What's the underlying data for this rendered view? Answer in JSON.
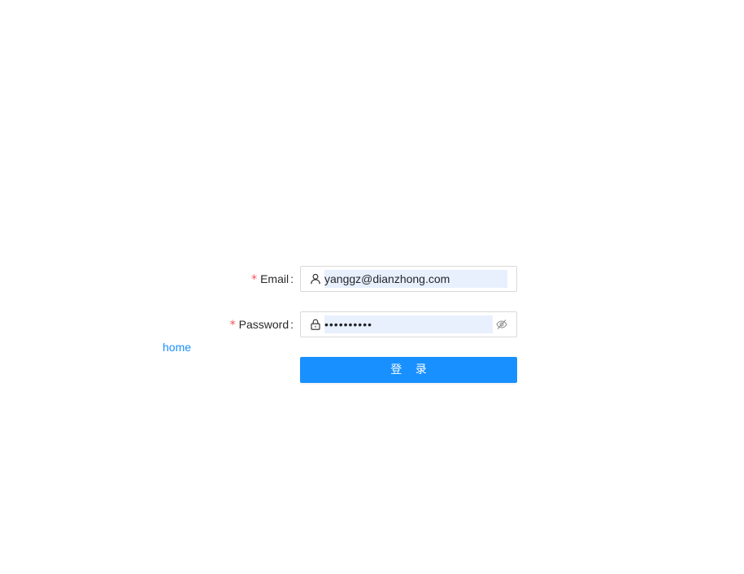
{
  "nav": {
    "home_label": "home"
  },
  "form": {
    "required_mark": "*",
    "colon": ":",
    "email": {
      "label": "Email",
      "value": "yanggz@dianzhong.com",
      "icon": "user-icon"
    },
    "password": {
      "label": "Password",
      "value": "••••••••••",
      "icon": "lock-icon",
      "toggle_icon": "eye-invisible-icon"
    },
    "submit_label": "登 录"
  },
  "colors": {
    "primary": "#1890ff",
    "required": "#ff4d4f",
    "autofill_bg": "#e8f0fe",
    "border": "#d9d9d9"
  }
}
